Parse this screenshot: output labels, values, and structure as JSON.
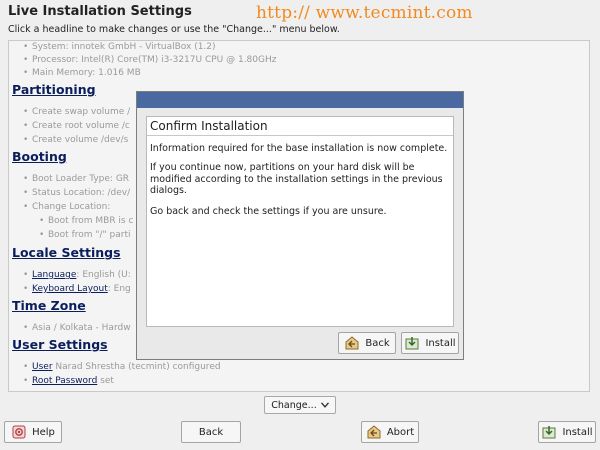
{
  "window": {
    "title": "Live Installation Settings",
    "subtitle": "Click a headline to make changes or use the \"Change...\" menu below."
  },
  "watermark": "http:// www.tecmint.com",
  "overview": {
    "system_items": [
      "System: innotek GmbH - VirtualBox (1.2)",
      "Processor: Intel(R) Core(TM) i3-3217U CPU @ 1.80GHz",
      "Main Memory: 1.016 MB"
    ],
    "partitioning": {
      "heading": "Partitioning",
      "items": [
        "Create swap volume /",
        "Create root volume /c",
        "Create volume /dev/s"
      ]
    },
    "booting": {
      "heading": "Booting",
      "items": [
        "Boot Loader Type: GR",
        "Status Location: /dev/",
        "Change Location:"
      ],
      "subitems": [
        "Boot from MBR is c",
        "Boot from \"/\" parti"
      ]
    },
    "locale": {
      "heading": "Locale Settings",
      "language_link": "Language",
      "language_value": ": English (U:",
      "keyboard_link": "Keyboard Layout",
      "keyboard_value": ": Eng"
    },
    "timezone": {
      "heading": "Time Zone",
      "item": "Asia / Kolkata - Hardw"
    },
    "users": {
      "heading": "User Settings",
      "user_link": "User",
      "user_value": " Narad Shrestha (tecmint) configured",
      "root_link": "Root Password",
      "root_value": " set"
    }
  },
  "change_menu": {
    "label": "Change...",
    "icon": "chevron-down-icon"
  },
  "footer": {
    "help_label": "Help",
    "back_label": "Back",
    "abort_label": "Abort",
    "install_label": "Install"
  },
  "dialog": {
    "title": "Confirm Installation",
    "text1": "Information required for the base installation is now complete.",
    "text2": "If you continue now, partitions on your hard disk will be modified according to the installation settings in the previous dialogs.",
    "text3": "Go back and check the settings if you are unsure.",
    "back_label": "Back",
    "install_label": "Install"
  },
  "colors": {
    "dialog_titlebar": "#4b69a1",
    "heading_link": "#0b1e5c",
    "watermark": "#f28a1e",
    "greyed_text": "#9a9a9a"
  }
}
